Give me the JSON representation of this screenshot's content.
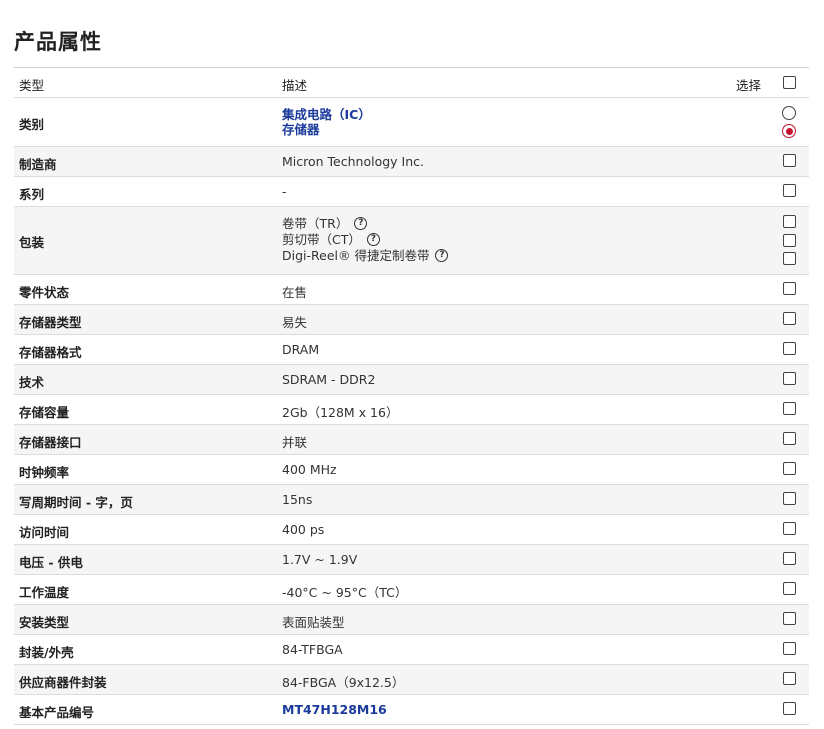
{
  "page_title": "产品属性",
  "header": {
    "col_type": "类型",
    "col_desc": "描述",
    "col_select": "选择"
  },
  "category": {
    "label": "类别",
    "values": [
      "集成电路（IC）",
      "存储器"
    ]
  },
  "manufacturer": {
    "label": "制造商",
    "value": "Micron Technology Inc."
  },
  "series": {
    "label": "系列",
    "value": "-"
  },
  "packaging": {
    "label": "包装",
    "options": [
      "卷带（TR）",
      "剪切带（CT）",
      "Digi-Reel® 得捷定制卷带"
    ]
  },
  "rows": [
    {
      "label": "零件状态",
      "value": "在售"
    },
    {
      "label": "存储器类型",
      "value": "易失"
    },
    {
      "label": "存储器格式",
      "value": "DRAM"
    },
    {
      "label": "技术",
      "value": "SDRAM - DDR2"
    },
    {
      "label": "存储容量",
      "value": "2Gb（128M x 16）"
    },
    {
      "label": "存储器接口",
      "value": "并联"
    },
    {
      "label": "时钟频率",
      "value": "400 MHz"
    },
    {
      "label": "写周期时间 - 字，页",
      "value": "15ns"
    },
    {
      "label": "访问时间",
      "value": "400 ps"
    },
    {
      "label": "电压 - 供电",
      "value": "1.7V ~ 1.9V"
    },
    {
      "label": "工作温度",
      "value": "-40°C ~ 95°C（TC）"
    },
    {
      "label": "安装类型",
      "value": "表面贴装型"
    },
    {
      "label": "封装/外壳",
      "value": "84-TFBGA"
    },
    {
      "label": "供应商器件封装",
      "value": "84-FBGA（9x12.5）"
    }
  ],
  "base_product": {
    "label": "基本产品编号",
    "value": "MT47H128M16"
  },
  "colors": {
    "link": "#1b3a9c",
    "radio_selected": "#c8102e",
    "alt_row": "#f5f5f5"
  }
}
